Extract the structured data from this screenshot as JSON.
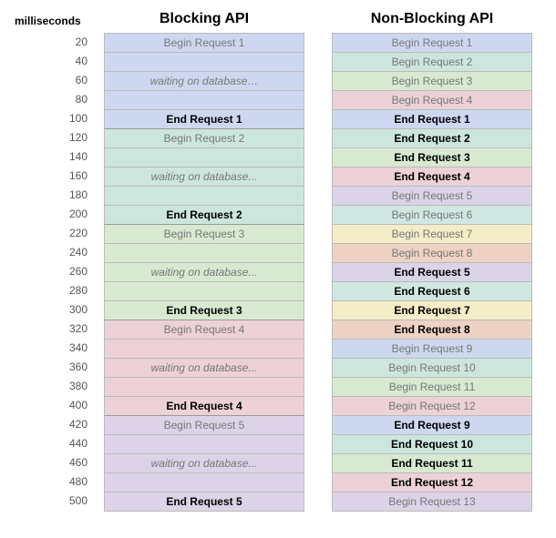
{
  "header": {
    "ms_label": "milliseconds",
    "blocking_title": "Blocking API",
    "nonblocking_title": "Non-Blocking API"
  },
  "ms": [
    "20",
    "40",
    "60",
    "80",
    "100",
    "120",
    "140",
    "160",
    "180",
    "200",
    "220",
    "240",
    "260",
    "280",
    "300",
    "320",
    "340",
    "360",
    "380",
    "400",
    "420",
    "440",
    "460",
    "480",
    "500"
  ],
  "blocking": [
    {
      "text": "Begin Request 1",
      "type": "begin",
      "group": 1
    },
    {
      "text": "",
      "type": "blank",
      "group": 1
    },
    {
      "text": "waiting on database…",
      "type": "waiting",
      "group": 1
    },
    {
      "text": "",
      "type": "blank",
      "group": 1
    },
    {
      "text": "End Request 1",
      "type": "end",
      "group": 1,
      "sep": true
    },
    {
      "text": "Begin Request 2",
      "type": "begin",
      "group": 2
    },
    {
      "text": "",
      "type": "blank",
      "group": 2
    },
    {
      "text": "waiting on database...",
      "type": "waiting",
      "group": 2
    },
    {
      "text": "",
      "type": "blank",
      "group": 2
    },
    {
      "text": "End Request 2",
      "type": "end",
      "group": 2,
      "sep": true
    },
    {
      "text": "Begin Request 3",
      "type": "begin",
      "group": 3
    },
    {
      "text": "",
      "type": "blank",
      "group": 3
    },
    {
      "text": "waiting on database...",
      "type": "waiting",
      "group": 3
    },
    {
      "text": "",
      "type": "blank",
      "group": 3
    },
    {
      "text": "End Request 3",
      "type": "end",
      "group": 3,
      "sep": true
    },
    {
      "text": "Begin Request 4",
      "type": "begin",
      "group": 4
    },
    {
      "text": "",
      "type": "blank",
      "group": 4
    },
    {
      "text": "waiting on database...",
      "type": "waiting",
      "group": 4
    },
    {
      "text": "",
      "type": "blank",
      "group": 4
    },
    {
      "text": "End Request 4",
      "type": "end",
      "group": 4,
      "sep": true
    },
    {
      "text": "Begin Request 5",
      "type": "begin",
      "group": 5
    },
    {
      "text": "",
      "type": "blank",
      "group": 5
    },
    {
      "text": "waiting on database...",
      "type": "waiting",
      "group": 5
    },
    {
      "text": "",
      "type": "blank",
      "group": 5
    },
    {
      "text": "End Request 5",
      "type": "end",
      "group": 5
    }
  ],
  "nonblocking": [
    {
      "text": "Begin Request 1",
      "type": "begin",
      "group": 1
    },
    {
      "text": "Begin Request 2",
      "type": "begin",
      "group": 2
    },
    {
      "text": "Begin Request 3",
      "type": "begin",
      "group": 3
    },
    {
      "text": "Begin Request 4",
      "type": "begin",
      "group": 4
    },
    {
      "text": "End Request 1",
      "type": "end",
      "group": 1
    },
    {
      "text": "End Request 2",
      "type": "end",
      "group": 2
    },
    {
      "text": "End Request 3",
      "type": "end",
      "group": 3
    },
    {
      "text": "End Request 4",
      "type": "end",
      "group": 4
    },
    {
      "text": "Begin Request 5",
      "type": "begin",
      "group": 5
    },
    {
      "text": "Begin Request 6",
      "type": "begin",
      "group": 6
    },
    {
      "text": "Begin Request 7",
      "type": "begin",
      "group": 7
    },
    {
      "text": "Begin Request 8",
      "type": "begin",
      "group": 8
    },
    {
      "text": "End Request 5",
      "type": "end",
      "group": 5
    },
    {
      "text": "End Request 6",
      "type": "end",
      "group": 6
    },
    {
      "text": "End Request 7",
      "type": "end",
      "group": 7
    },
    {
      "text": "End Request 8",
      "type": "end",
      "group": 8
    },
    {
      "text": "Begin Request 9",
      "type": "begin",
      "group": 1
    },
    {
      "text": "Begin Request 10",
      "type": "begin",
      "group": 2
    },
    {
      "text": "Begin Request 11",
      "type": "begin",
      "group": 3
    },
    {
      "text": "Begin Request 12",
      "type": "begin",
      "group": 4
    },
    {
      "text": "End Request 9",
      "type": "end",
      "group": 1
    },
    {
      "text": "End Request 10",
      "type": "end",
      "group": 2
    },
    {
      "text": "End Request 11",
      "type": "end",
      "group": 3
    },
    {
      "text": "End Request 12",
      "type": "end",
      "group": 4
    },
    {
      "text": "Begin Request 13",
      "type": "begin",
      "group": 5
    }
  ],
  "chart_data": {
    "type": "table",
    "title": "Blocking vs Non-Blocking API request timeline",
    "xlabel": "milliseconds",
    "x": [
      20,
      40,
      60,
      80,
      100,
      120,
      140,
      160,
      180,
      200,
      220,
      240,
      260,
      280,
      300,
      320,
      340,
      360,
      380,
      400,
      420,
      440,
      460,
      480,
      500
    ],
    "series": [
      {
        "name": "Blocking API",
        "events": [
          {
            "ms": 20,
            "event": "Begin Request 1"
          },
          {
            "ms": 60,
            "event": "waiting on database…"
          },
          {
            "ms": 100,
            "event": "End Request 1"
          },
          {
            "ms": 120,
            "event": "Begin Request 2"
          },
          {
            "ms": 160,
            "event": "waiting on database..."
          },
          {
            "ms": 200,
            "event": "End Request 2"
          },
          {
            "ms": 220,
            "event": "Begin Request 3"
          },
          {
            "ms": 260,
            "event": "waiting on database..."
          },
          {
            "ms": 300,
            "event": "End Request 3"
          },
          {
            "ms": 320,
            "event": "Begin Request 4"
          },
          {
            "ms": 360,
            "event": "waiting on database..."
          },
          {
            "ms": 400,
            "event": "End Request 4"
          },
          {
            "ms": 420,
            "event": "Begin Request 5"
          },
          {
            "ms": 460,
            "event": "waiting on database..."
          },
          {
            "ms": 500,
            "event": "End Request 5"
          }
        ]
      },
      {
        "name": "Non-Blocking API",
        "events": [
          {
            "ms": 20,
            "event": "Begin Request 1"
          },
          {
            "ms": 40,
            "event": "Begin Request 2"
          },
          {
            "ms": 60,
            "event": "Begin Request 3"
          },
          {
            "ms": 80,
            "event": "Begin Request 4"
          },
          {
            "ms": 100,
            "event": "End Request 1"
          },
          {
            "ms": 120,
            "event": "End Request 2"
          },
          {
            "ms": 140,
            "event": "End Request 3"
          },
          {
            "ms": 160,
            "event": "End Request 4"
          },
          {
            "ms": 180,
            "event": "Begin Request 5"
          },
          {
            "ms": 200,
            "event": "Begin Request 6"
          },
          {
            "ms": 220,
            "event": "Begin Request 7"
          },
          {
            "ms": 240,
            "event": "Begin Request 8"
          },
          {
            "ms": 260,
            "event": "End Request 5"
          },
          {
            "ms": 280,
            "event": "End Request 6"
          },
          {
            "ms": 300,
            "event": "End Request 7"
          },
          {
            "ms": 320,
            "event": "End Request 8"
          },
          {
            "ms": 340,
            "event": "Begin Request 9"
          },
          {
            "ms": 360,
            "event": "Begin Request 10"
          },
          {
            "ms": 380,
            "event": "Begin Request 11"
          },
          {
            "ms": 400,
            "event": "Begin Request 12"
          },
          {
            "ms": 420,
            "event": "End Request 9"
          },
          {
            "ms": 440,
            "event": "End Request 10"
          },
          {
            "ms": 460,
            "event": "End Request 11"
          },
          {
            "ms": 480,
            "event": "End Request 12"
          },
          {
            "ms": 500,
            "event": "Begin Request 13"
          }
        ]
      }
    ]
  }
}
